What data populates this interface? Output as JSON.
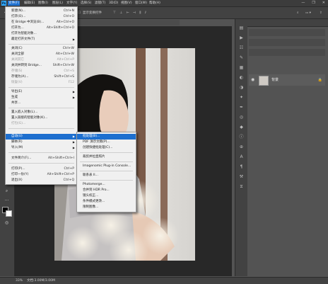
{
  "menubar": {
    "items": [
      "文件(F)",
      "编辑(E)",
      "图像(I)",
      "图层(L)",
      "文字(Y)",
      "选择(S)",
      "滤镜(T)",
      "3D(D)",
      "视图(V)",
      "窗口(W)",
      "帮助(H)"
    ],
    "window_controls": [
      "—",
      "❐",
      "✕"
    ]
  },
  "options_bar": {
    "text1": "显示变换控件"
  },
  "file_menu": {
    "items": [
      {
        "label": "新建(N)...",
        "shortcut": "Ctrl+N"
      },
      {
        "label": "打开(O)...",
        "shortcut": "Ctrl+O"
      },
      {
        "label": "在 Bridge 中浏览(B)...",
        "shortcut": "Alt+Ctrl+O"
      },
      {
        "label": "打开为...",
        "shortcut": "Alt+Shift+Ctrl+O"
      },
      {
        "label": "打开为智能对象..."
      },
      {
        "label": "最近打开文件(T)"
      },
      {
        "label": "关闭(C)",
        "shortcut": "Ctrl+W"
      },
      {
        "label": "关闭全部",
        "shortcut": "Alt+Ctrl+W"
      },
      {
        "label": "关闭其它",
        "shortcut": "Alt+Ctrl+P"
      },
      {
        "label": "关闭并转到 Bridge...",
        "shortcut": "Shift+Ctrl+W"
      },
      {
        "label": "存储(S)",
        "shortcut": "Ctrl+S"
      },
      {
        "label": "存储为(A)...",
        "shortcut": "Shift+Ctrl+S"
      },
      {
        "label": "恢复(V)",
        "shortcut": "F12"
      },
      {
        "label": "导出(E)"
      },
      {
        "label": "生成"
      },
      {
        "label": "共享..."
      },
      {
        "label": "置入嵌入对象(L)..."
      },
      {
        "label": "置入链接的智能对象(K)..."
      },
      {
        "label": "打包(G)..."
      },
      {
        "label": "自动(U)"
      },
      {
        "label": "脚本(R)"
      },
      {
        "label": "导入(M)"
      },
      {
        "label": "文件简介(F)...",
        "shortcut": "Alt+Shift+Ctrl+I"
      },
      {
        "label": "打印(P)...",
        "shortcut": "Ctrl+P"
      },
      {
        "label": "打印一份(Y)",
        "shortcut": "Alt+Shift+Ctrl+P"
      },
      {
        "label": "退出(X)",
        "shortcut": "Ctrl+Q"
      }
    ]
  },
  "automate_menu": {
    "items": [
      "批处理(B)...",
      "PDF 演示文稿(P)...",
      "创建快捷批处理(C)...",
      "裁剪并拉直照片",
      "Imagenomic Plug-in Console...",
      "联系表 II...",
      "Photomerge...",
      "合并到 HDR Pro...",
      "镜头校正...",
      "条件模式更改...",
      "限制图像..."
    ]
  },
  "status": {
    "zoom": "33%",
    "doc": "文档:3.00M/3.00M"
  },
  "layers": {
    "layer_name": "背景"
  }
}
